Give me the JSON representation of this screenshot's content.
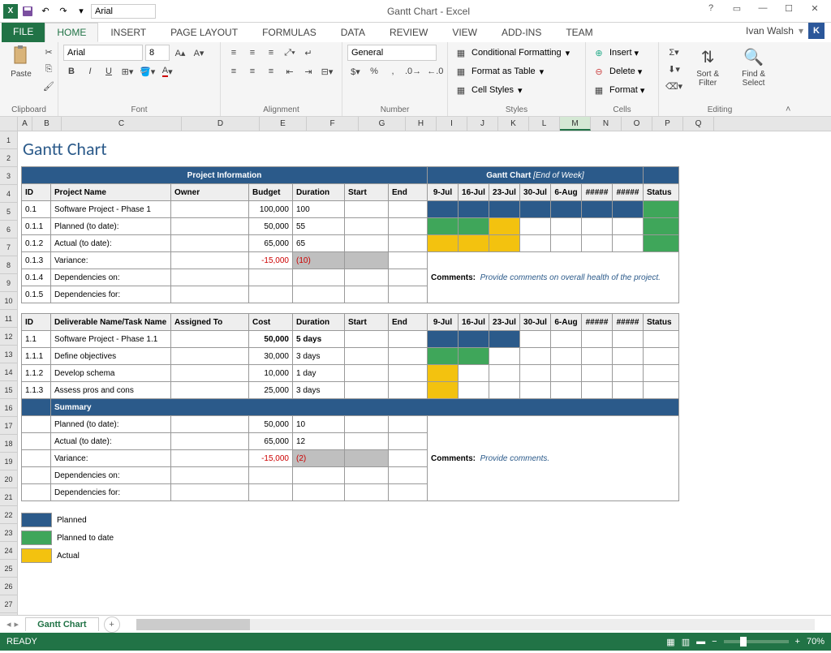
{
  "app": {
    "title": "Gantt Chart - Excel",
    "user": "Ivan Walsh",
    "user_initial": "K"
  },
  "qat": {
    "font": "Arial"
  },
  "tabs": {
    "file": "FILE",
    "list": [
      "HOME",
      "INSERT",
      "PAGE LAYOUT",
      "FORMULAS",
      "DATA",
      "REVIEW",
      "VIEW",
      "ADD-INS",
      "TEAM"
    ],
    "active": 0
  },
  "ribbon": {
    "clipboard": {
      "label": "Clipboard",
      "paste": "Paste"
    },
    "font": {
      "label": "Font",
      "family": "Arial",
      "size": "8"
    },
    "alignment": {
      "label": "Alignment"
    },
    "number": {
      "label": "Number",
      "format": "General"
    },
    "styles": {
      "label": "Styles",
      "cond": "Conditional Formatting",
      "table": "Format as Table",
      "cell": "Cell Styles"
    },
    "cells": {
      "label": "Cells",
      "insert": "Insert",
      "delete": "Delete",
      "format": "Format"
    },
    "editing": {
      "label": "Editing",
      "sort": "Sort & Filter",
      "find": "Find & Select"
    }
  },
  "cols": [
    "A",
    "B",
    "C",
    "D",
    "E",
    "F",
    "G",
    "H",
    "I",
    "J",
    "K",
    "L",
    "M",
    "N",
    "O",
    "P",
    "Q"
  ],
  "rows": [
    "1",
    "2",
    "3",
    "4",
    "5",
    "6",
    "7",
    "8",
    "9",
    "10",
    "11",
    "12",
    "13",
    "14",
    "15",
    "16",
    "17",
    "18",
    "19",
    "20",
    "21",
    "22",
    "23",
    "24",
    "25",
    "26",
    "27"
  ],
  "sheet": {
    "title": "Gantt Chart",
    "sec1_title": "Project Information",
    "sec1_gantt": "Gantt Chart",
    "sec1_gantt_sub": "[End of Week]",
    "h1": {
      "id": "ID",
      "name": "Project Name",
      "owner": "Owner",
      "budget": "Budget",
      "dur": "Duration",
      "start": "Start",
      "end": "End",
      "status": "Status"
    },
    "dates": [
      "9-Jul",
      "16-Jul",
      "23-Jul",
      "30-Jul",
      "6-Aug",
      "#####",
      "#####"
    ],
    "r1": [
      {
        "id": "0.1",
        "name": "Software Project - Phase 1",
        "budget": "100,000",
        "dur": "100",
        "g": [
          "navy",
          "navy",
          "navy",
          "navy",
          "navy",
          "navy",
          "navy"
        ],
        "st": "green"
      },
      {
        "id": "0.1.1",
        "name": "Planned (to date):",
        "budget": "50,000",
        "dur": "55",
        "g": [
          "green",
          "green",
          "yellow",
          "",
          "",
          "",
          ""
        ],
        "st": "green"
      },
      {
        "id": "0.1.2",
        "name": "Actual (to date):",
        "budget": "65,000",
        "dur": "65",
        "g": [
          "yellow",
          "yellow",
          "yellow",
          "",
          "",
          "",
          ""
        ],
        "st": "green"
      },
      {
        "id": "0.1.3",
        "name": "Variance:",
        "budget": "-15,000",
        "dur": "(10)",
        "neg": true,
        "gray": true
      },
      {
        "id": "0.1.4",
        "name": "Dependencies on:"
      },
      {
        "id": "0.1.5",
        "name": "Dependencies for:"
      }
    ],
    "comments1_label": "Comments:",
    "comments1": "Provide comments on overall health of the project.",
    "h2": {
      "id": "ID",
      "name": "Deliverable Name/Task Name",
      "owner": "Assigned To",
      "budget": "Cost",
      "dur": "Duration",
      "start": "Start",
      "end": "End",
      "status": "Status"
    },
    "r2": [
      {
        "id": "1.1",
        "name": "Software Project - Phase 1.1",
        "budget": "50,000",
        "dur": "5 days",
        "bold": true,
        "g": [
          "navy",
          "navy",
          "navy",
          "",
          "",
          "",
          ""
        ]
      },
      {
        "id": "1.1.1",
        "name": "Define objectives",
        "budget": "30,000",
        "dur": "3 days",
        "g": [
          "green",
          "green",
          "",
          "",
          "",
          "",
          ""
        ]
      },
      {
        "id": "1.1.2",
        "name": "Develop schema",
        "budget": "10,000",
        "dur": "1 day",
        "g": [
          "yellow",
          "",
          "",
          "",
          "",
          "",
          ""
        ]
      },
      {
        "id": "1.1.3",
        "name": "Assess pros and cons",
        "budget": "25,000",
        "dur": "3 days",
        "g": [
          "yellow",
          "",
          "",
          "",
          "",
          "",
          ""
        ]
      }
    ],
    "summary": "Summary",
    "r3": [
      {
        "name": "Planned (to date):",
        "budget": "50,000",
        "dur": "10"
      },
      {
        "name": "Actual (to date):",
        "budget": "65,000",
        "dur": "12"
      },
      {
        "name": "Variance:",
        "budget": "-15,000",
        "dur": "(2)",
        "neg": true,
        "gray": true
      },
      {
        "name": "Dependencies on:"
      },
      {
        "name": "Dependencies for:"
      }
    ],
    "comments2_label": "Comments:",
    "comments2": "Provide comments.",
    "legend": [
      {
        "color": "navy",
        "label": "Planned"
      },
      {
        "color": "green",
        "label": "Planned to date"
      },
      {
        "color": "yellow",
        "label": "Actual"
      }
    ]
  },
  "sheettab": "Gantt Chart",
  "status": {
    "ready": "READY",
    "zoom": "70%"
  }
}
